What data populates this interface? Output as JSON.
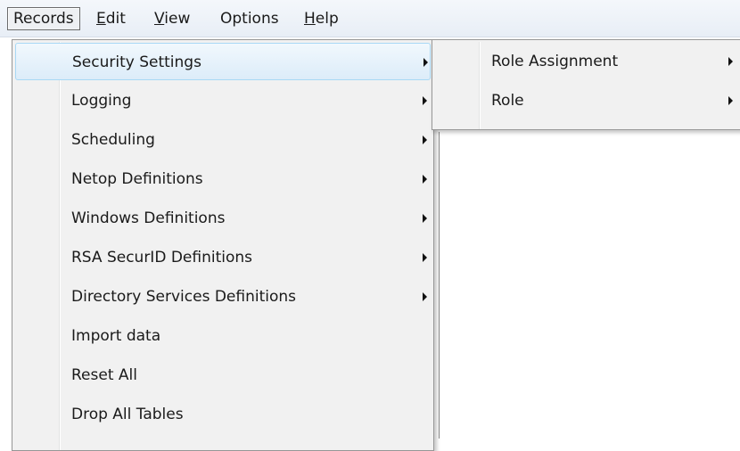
{
  "menubar": {
    "items": [
      {
        "label": "Records"
      },
      {
        "label": "Edit",
        "accel": "E",
        "rest": "dit"
      },
      {
        "label": "View",
        "accel": "V",
        "rest": "iew"
      },
      {
        "label": "Options"
      },
      {
        "label": "Help",
        "accel": "H",
        "rest": "elp"
      }
    ]
  },
  "records_menu": {
    "items": [
      {
        "label": "Security Settings",
        "submenu": true
      },
      {
        "label": "Logging",
        "submenu": true
      },
      {
        "label": "Scheduling",
        "submenu": true
      },
      {
        "label": "Netop Definitions",
        "submenu": true
      },
      {
        "label": "Windows Definitions",
        "submenu": true
      },
      {
        "label": "RSA SecurID Definitions",
        "submenu": true
      },
      {
        "label": "Directory Services Definitions",
        "submenu": true
      },
      {
        "label": "Import data",
        "submenu": false
      },
      {
        "label": "Reset All",
        "submenu": false
      },
      {
        "label": "Drop All Tables",
        "submenu": false
      }
    ]
  },
  "security_submenu": {
    "items": [
      {
        "label": "Role Assignment",
        "submenu": true
      },
      {
        "label": "Role",
        "submenu": true
      }
    ]
  }
}
